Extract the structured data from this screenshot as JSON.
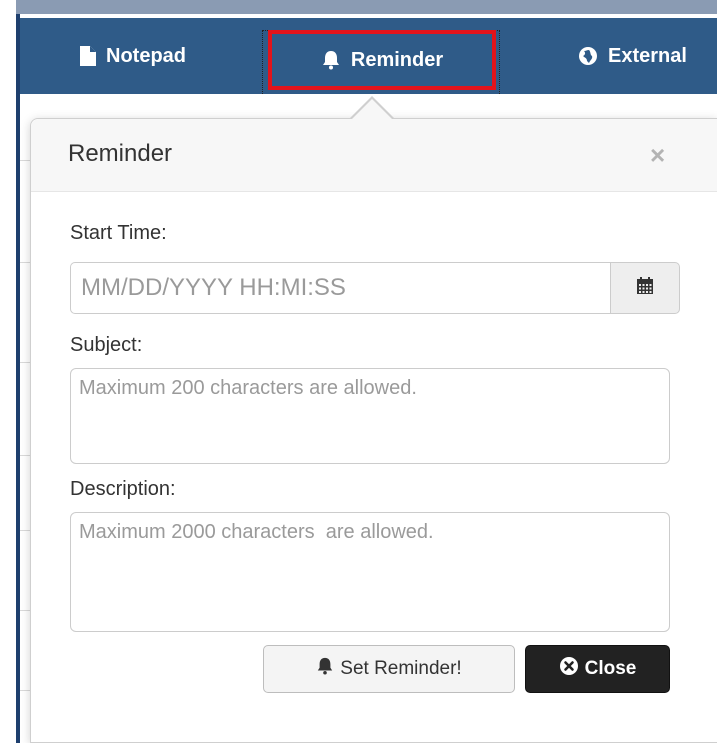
{
  "nav": {
    "items": [
      {
        "label": "Notepad",
        "icon": "file-icon"
      },
      {
        "label": "Reminder",
        "icon": "bell-icon"
      },
      {
        "label": "External",
        "icon": "globe-icon"
      }
    ]
  },
  "popover": {
    "title": "Reminder",
    "close_glyph": "×"
  },
  "form": {
    "start_time_label": "Start Time:",
    "start_time_placeholder": "MM/DD/YYYY HH:MI:SS",
    "subject_label": "Subject:",
    "subject_placeholder": "Maximum 200 characters are allowed.",
    "description_label": "Description:",
    "description_placeholder": "Maximum 2000 characters  are allowed."
  },
  "buttons": {
    "set_reminder": "Set Reminder!",
    "close": "Close"
  },
  "colors": {
    "navbar": "#2f5b88",
    "highlight": "#e3141b"
  }
}
